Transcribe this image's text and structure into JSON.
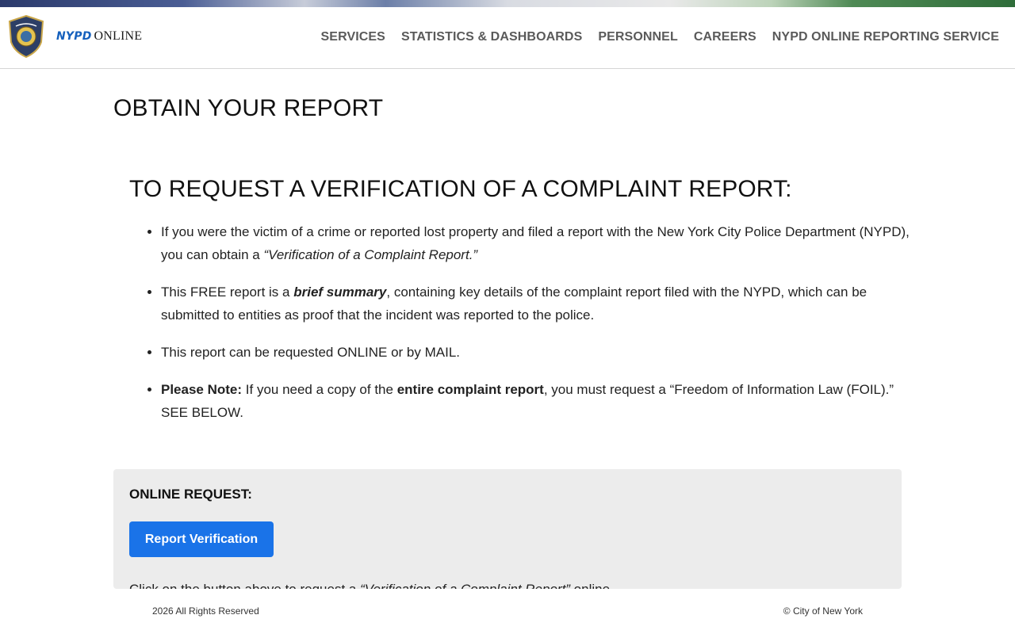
{
  "header": {
    "brand_nypd": "NYPD",
    "brand_online": "ONLINE",
    "nav": [
      "SERVICES",
      "STATISTICS & DASHBOARDS",
      "PERSONNEL",
      "CAREERS",
      "NYPD ONLINE REPORTING SERVICE"
    ]
  },
  "page": {
    "title": "OBTAIN YOUR REPORT",
    "section_title": "TO REQUEST A VERIFICATION OF A COMPLAINT REPORT:",
    "bullets": {
      "b1_text": "If you were the victim of a crime or reported lost property and filed a report with the New York City Police Department (NYPD), you can obtain a ",
      "b1_italic": "“Verification of a Complaint Report.”",
      "b2_before": "This FREE report is a ",
      "b2_bold": "brief summary",
      "b2_after": ", containing key details of the complaint report filed with the NYPD, which can be submitted to entities as proof that the incident was reported to the police.",
      "b3_text": "This report can be requested ONLINE or by MAIL.",
      "b4_label": "Please Note:",
      "b4_before": " If you need a copy of the ",
      "b4_bold": "entire complaint report",
      "b4_after": ", you must request a “Freedom of Information Law (FOIL).” SEE BELOW."
    },
    "online": {
      "title": "ONLINE REQUEST:",
      "button": "Report Verification",
      "note_before": "Click on the button above to request a ",
      "note_italic": "“Verification of a Complaint Report”",
      "note_after": " online."
    }
  },
  "footer": {
    "copyright": "2026 All Rights Reserved",
    "city": "© City of New York"
  }
}
